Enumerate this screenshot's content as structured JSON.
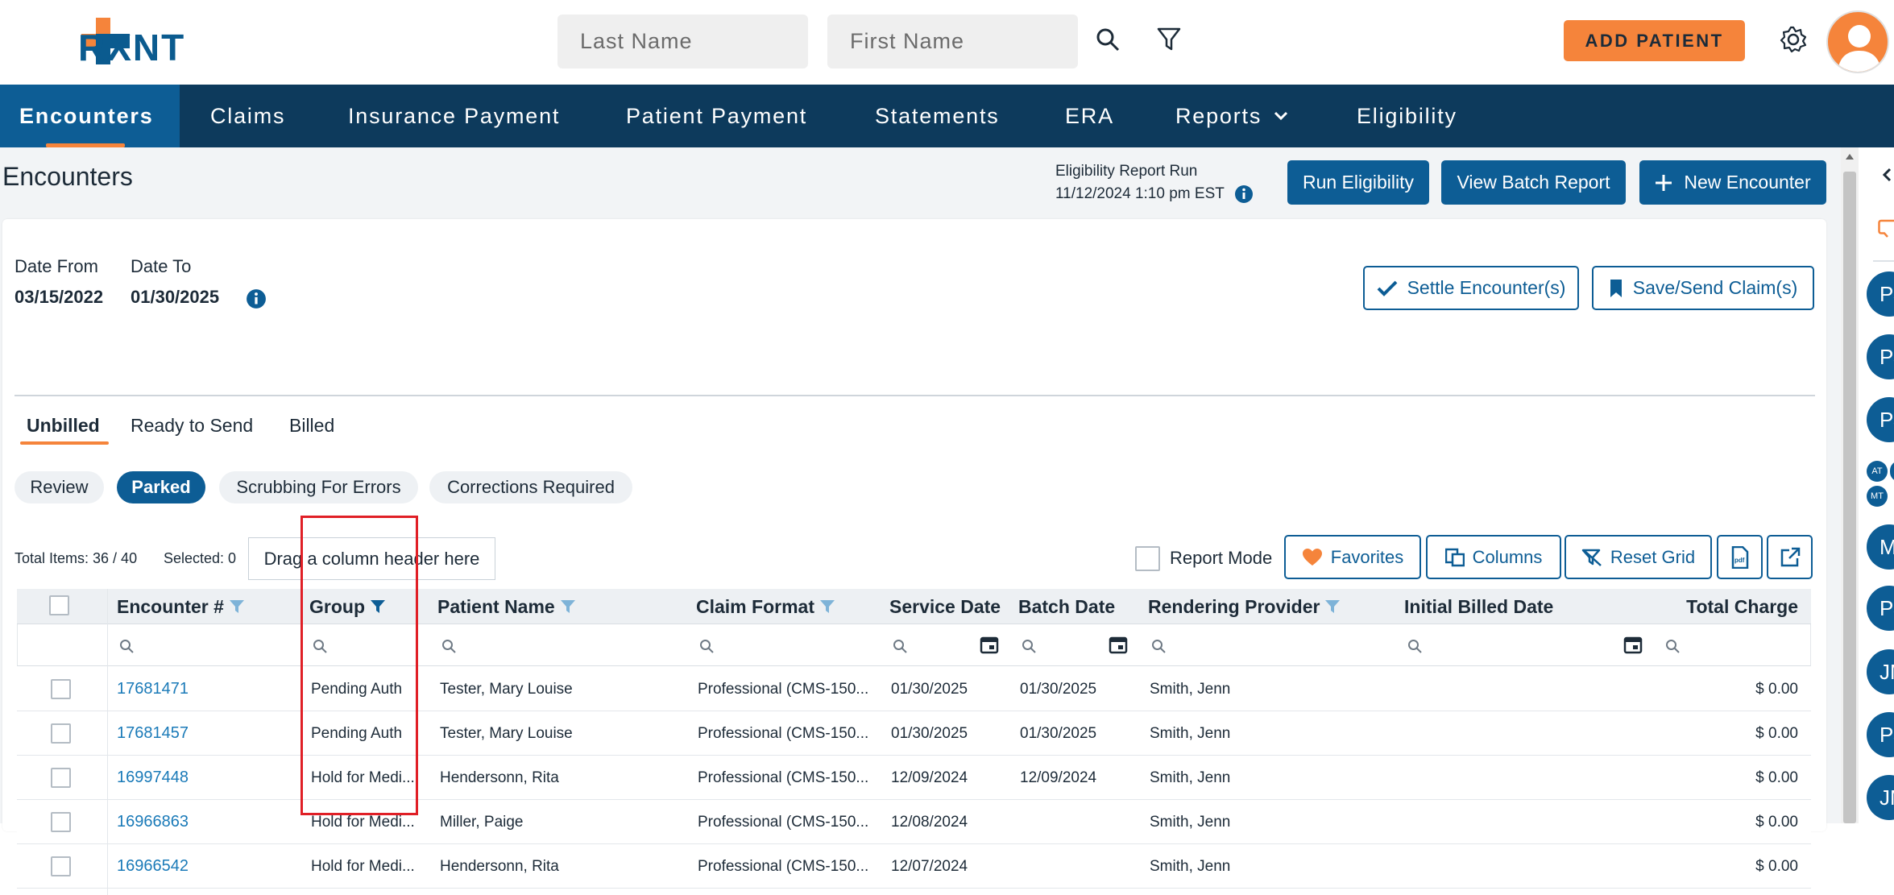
{
  "header": {
    "logo_text": "RXNT",
    "last_name_placeholder": "Last Name",
    "first_name_placeholder": "First Name",
    "add_patient_label": "ADD PATIENT"
  },
  "nav": {
    "items": [
      "Encounters",
      "Claims",
      "Insurance Payment",
      "Patient Payment",
      "Statements",
      "ERA",
      "Reports",
      "Eligibility"
    ]
  },
  "page": {
    "title": "Encounters",
    "eligibility_label": "Eligibility Report Run",
    "eligibility_time": "11/12/2024 1:10 pm EST",
    "run_eligibility": "Run Eligibility",
    "view_batch_report": "View Batch Report",
    "new_encounter": "New Encounter"
  },
  "filters": {
    "date_from_label": "Date From",
    "date_from": "03/15/2022",
    "date_to_label": "Date To",
    "date_to": "01/30/2025",
    "settle_label": "Settle Encounter(s)",
    "save_send_label": "Save/Send Claim(s)"
  },
  "tabs": [
    "Unbilled",
    "Ready to Send",
    "Billed"
  ],
  "chips": [
    "Review",
    "Parked",
    "Scrubbing For Errors",
    "Corrections Required"
  ],
  "toolbar": {
    "total_items": "Total Items: 36 / 40",
    "selected": "Selected: 0",
    "drag_hint": "Drag a column header here",
    "report_mode": "Report Mode",
    "favorites": "Favorites",
    "columns": "Columns",
    "reset_grid": "Reset Grid"
  },
  "grid": {
    "columns": [
      "Encounter #",
      "Group",
      "Patient Name",
      "Claim Format",
      "Service Date",
      "Batch Date",
      "Rendering Provider",
      "Initial Billed Date",
      "Total Charge"
    ],
    "rows": [
      {
        "encounter": "17681471",
        "group": "Pending Auth",
        "patient": "Tester, Mary Louise",
        "claim_format": "Professional (CMS-150...",
        "service_date": "01/30/2025",
        "batch_date": "01/30/2025",
        "provider": "Smith, Jenn",
        "initial_billed": "",
        "total": "$ 0.00"
      },
      {
        "encounter": "17681457",
        "group": "Pending Auth",
        "patient": "Tester, Mary Louise",
        "claim_format": "Professional (CMS-150...",
        "service_date": "01/30/2025",
        "batch_date": "01/30/2025",
        "provider": "Smith, Jenn",
        "initial_billed": "",
        "total": "$ 0.00"
      },
      {
        "encounter": "16997448",
        "group": "Hold for Medi...",
        "patient": "Hendersonn, Rita",
        "claim_format": "Professional (CMS-150...",
        "service_date": "12/09/2024",
        "batch_date": "12/09/2024",
        "provider": "Smith, Jenn",
        "initial_billed": "",
        "total": "$ 0.00"
      },
      {
        "encounter": "16966863",
        "group": "Hold for Medi...",
        "patient": "Miller, Paige",
        "claim_format": "Professional (CMS-150...",
        "service_date": "12/08/2024",
        "batch_date": "",
        "provider": "Smith, Jenn",
        "initial_billed": "",
        "total": "$ 0.00"
      },
      {
        "encounter": "16966542",
        "group": "Hold for Medi...",
        "patient": "Hendersonn, Rita",
        "claim_format": "Professional (CMS-150...",
        "service_date": "12/07/2024",
        "batch_date": "",
        "provider": "Smith, Jenn",
        "initial_billed": "",
        "total": "$ 0.00"
      }
    ]
  },
  "rail": {
    "avatars": [
      "PJ",
      "PJ",
      "PJ",
      "MT",
      "PJ",
      "JM",
      "PJ",
      "JM"
    ],
    "mini": [
      "AT",
      "MT"
    ]
  },
  "colors": {
    "brand_blue": "#0d5d95",
    "nav_dark": "#0d3a5c",
    "accent_orange": "#f5843b",
    "highlight_red": "#e01f26"
  }
}
